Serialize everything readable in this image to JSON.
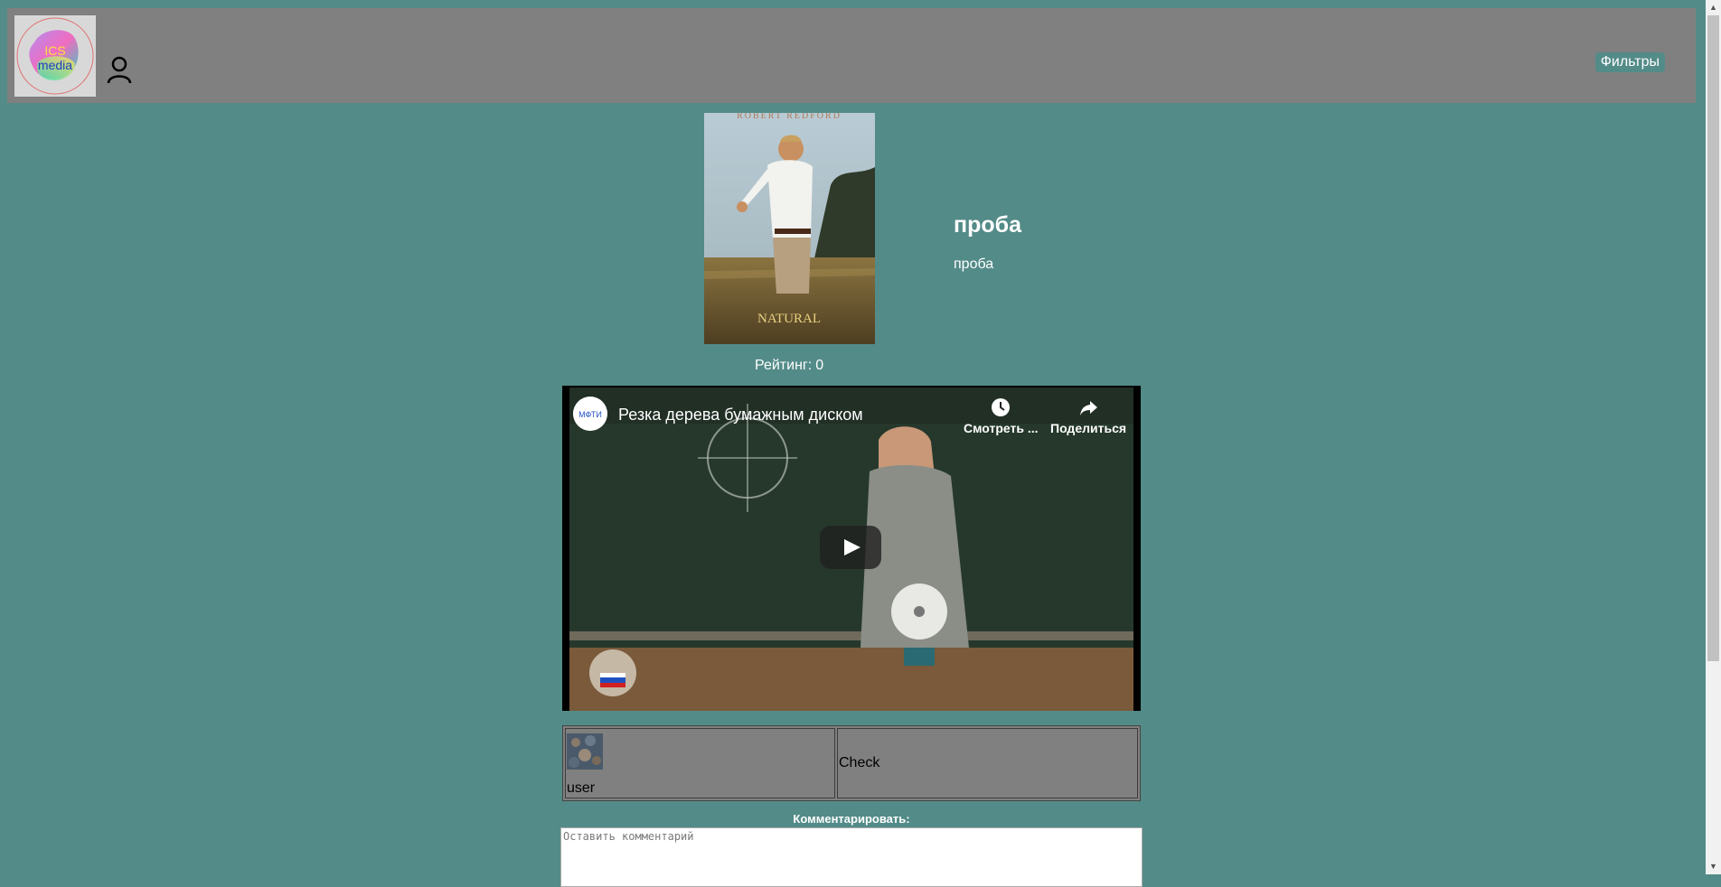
{
  "header": {
    "logo_text_line1": "ICS",
    "logo_text_line2": "media",
    "filters_label": "Фильтры"
  },
  "movie": {
    "poster_top_text": "ROBERT REDFORD",
    "poster_bottom_text": "NATURAL",
    "title": "проба",
    "description": "проба",
    "rating_label": "Рейтинг:",
    "rating_value": "0"
  },
  "video": {
    "title": "Резка дерева бумажным диском",
    "channel_avatar_text": "МФТИ",
    "watch_later_label": "Смотреть ...",
    "share_label": "Поделиться"
  },
  "comments": [
    {
      "author": "user",
      "text": "Check"
    }
  ],
  "comment_form": {
    "label": "Комментарировать:",
    "placeholder": "Оставить комментарий"
  },
  "colors": {
    "page_background": "#538b88",
    "header_background": "#808080",
    "filter_button_background": "#538b88"
  }
}
